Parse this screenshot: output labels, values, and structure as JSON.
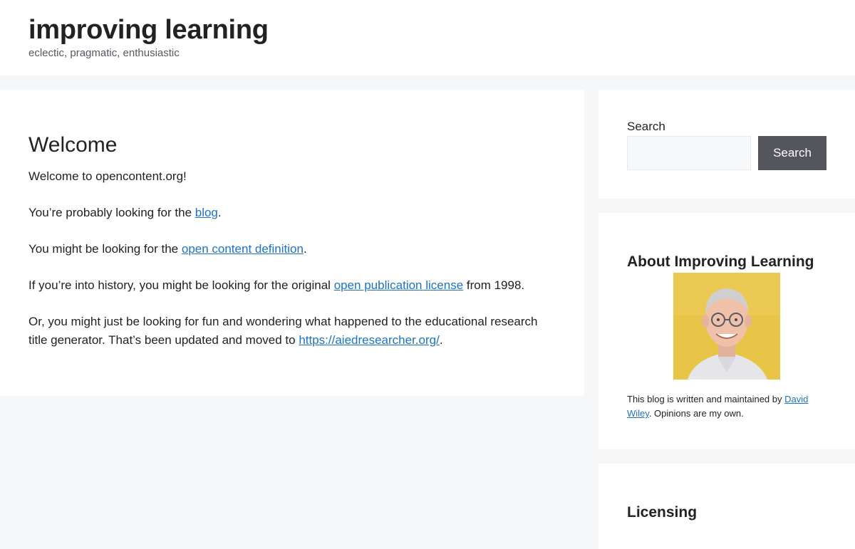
{
  "header": {
    "site_title": "improving learning",
    "tagline": "eclectic, pragmatic, enthusiastic"
  },
  "main": {
    "page_title": "Welcome",
    "p1": "Welcome to opencontent.org!",
    "p2_before": "You’re probably looking for the ",
    "p2_link": "blog",
    "p2_after": ".",
    "p3_before": "You might be looking for the ",
    "p3_link": "open content definition",
    "p3_after": ".",
    "p4_before": "If you’re into history, you might be looking for the original ",
    "p4_link": "open publication license",
    "p4_after": " from 1998.",
    "p5_before": "Or, you might just be looking for fun and wondering what happened to the educational research title generator. That’s been updated and moved to ",
    "p5_link": "https://aiedresearcher.org/",
    "p5_after": "."
  },
  "sidebar": {
    "search": {
      "label": "Search",
      "input_value": "",
      "button_label": "Search"
    },
    "about": {
      "title": "About Improving Learning",
      "text_before": "This blog is written and maintained by ",
      "link": "David Wiley",
      "text_after": ". Opinions are my own."
    },
    "licensing": {
      "title": "Licensing"
    }
  },
  "colors": {
    "background": "#f6f7f8",
    "link": "#1e73be",
    "button": "#55555e",
    "text": "#222222"
  }
}
